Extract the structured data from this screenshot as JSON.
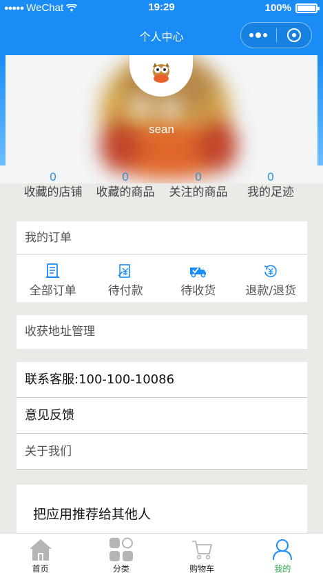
{
  "status_bar": {
    "carrier": "WeChat",
    "time": "19:29",
    "battery": "100%"
  },
  "nav": {
    "title": "个人中心"
  },
  "profile": {
    "username": "sean"
  },
  "stats": [
    {
      "count": "0",
      "label": "收藏的店铺"
    },
    {
      "count": "0",
      "label": "收藏的商品"
    },
    {
      "count": "0",
      "label": "关注的商品"
    },
    {
      "count": "0",
      "label": "我的足迹"
    }
  ],
  "orders": {
    "title": "我的订单",
    "items": [
      {
        "label": "全部订单",
        "icon": "order-list-icon"
      },
      {
        "label": "待付款",
        "icon": "payment-pending-icon"
      },
      {
        "label": "待收货",
        "icon": "delivery-truck-icon"
      },
      {
        "label": "退款/退货",
        "icon": "refund-icon"
      }
    ]
  },
  "address": {
    "label": "收获地址管理"
  },
  "service": {
    "contact": "联系客服:100-100-10086",
    "feedback": "意见反馈",
    "about": "关于我们"
  },
  "share": {
    "label": "把应用推荐给其他人"
  },
  "tabbar": {
    "items": [
      {
        "label": "首页",
        "icon": "home-icon"
      },
      {
        "label": "分类",
        "icon": "category-icon"
      },
      {
        "label": "购物车",
        "icon": "cart-icon"
      },
      {
        "label": "我的",
        "icon": "user-icon"
      }
    ]
  },
  "colors": {
    "primary": "#1a8cf5",
    "stat_number": "#2a8fd8",
    "tab_active": "#2aa745",
    "background": "#ebeae6"
  }
}
